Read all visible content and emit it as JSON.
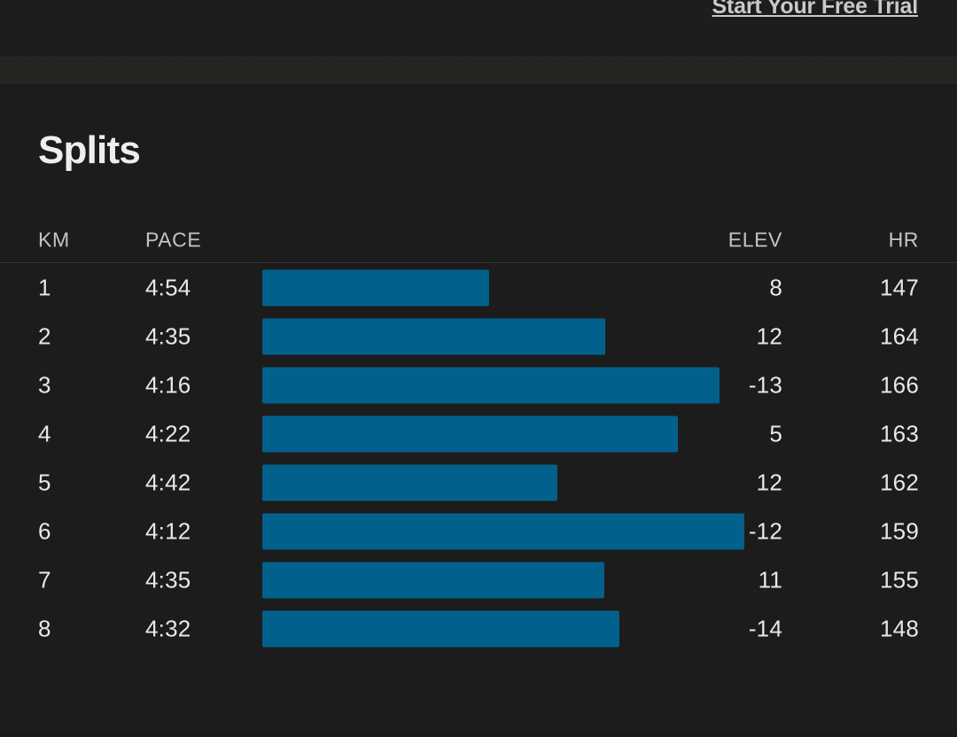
{
  "header": {
    "trial_link_label": "Start Your Free Trial"
  },
  "main": {
    "section_title": "Splits",
    "columns": {
      "km": "KM",
      "pace": "PACE",
      "elev": "ELEV",
      "hr": "HR"
    }
  },
  "colors": {
    "background": "#1c1c1c",
    "bar": "#02618c",
    "divider": "#333333",
    "text_primary": "#e8e8e8",
    "text_secondary": "#c4c4c4"
  },
  "chart_data": {
    "type": "bar",
    "title": "Splits",
    "xlabel": "",
    "ylabel": "KM",
    "categories": [
      "1",
      "2",
      "3",
      "4",
      "5",
      "6",
      "7",
      "8"
    ],
    "series": [
      {
        "name": "PACE",
        "values": [
          "4:54",
          "4:35",
          "4:16",
          "4:22",
          "4:42",
          "4:12",
          "4:35",
          "4:32"
        ]
      },
      {
        "name": "ELEV",
        "values": [
          8,
          12,
          -13,
          5,
          12,
          -12,
          11,
          -14
        ]
      },
      {
        "name": "HR",
        "values": [
          147,
          164,
          166,
          163,
          162,
          159,
          155,
          148
        ]
      }
    ],
    "bar_widths_pct": [
      47.0,
      71.2,
      94.9,
      86.3,
      61.2,
      100.0,
      71.0,
      74.0
    ],
    "grid": false,
    "legend": "none"
  },
  "rows": [
    {
      "km": "1",
      "pace": "4:54",
      "elev": "8",
      "hr": "147",
      "bar_pct": 47.0
    },
    {
      "km": "2",
      "pace": "4:35",
      "elev": "12",
      "hr": "164",
      "bar_pct": 71.2
    },
    {
      "km": "3",
      "pace": "4:16",
      "elev": "-13",
      "hr": "166",
      "bar_pct": 94.9
    },
    {
      "km": "4",
      "pace": "4:22",
      "elev": "5",
      "hr": "163",
      "bar_pct": 86.3
    },
    {
      "km": "5",
      "pace": "4:42",
      "elev": "12",
      "hr": "162",
      "bar_pct": 61.2
    },
    {
      "km": "6",
      "pace": "4:12",
      "elev": "-12",
      "hr": "159",
      "bar_pct": 100.0
    },
    {
      "km": "7",
      "pace": "4:35",
      "elev": "11",
      "hr": "155",
      "bar_pct": 71.0
    },
    {
      "km": "8",
      "pace": "4:32",
      "elev": "-14",
      "hr": "148",
      "bar_pct": 74.0
    }
  ]
}
